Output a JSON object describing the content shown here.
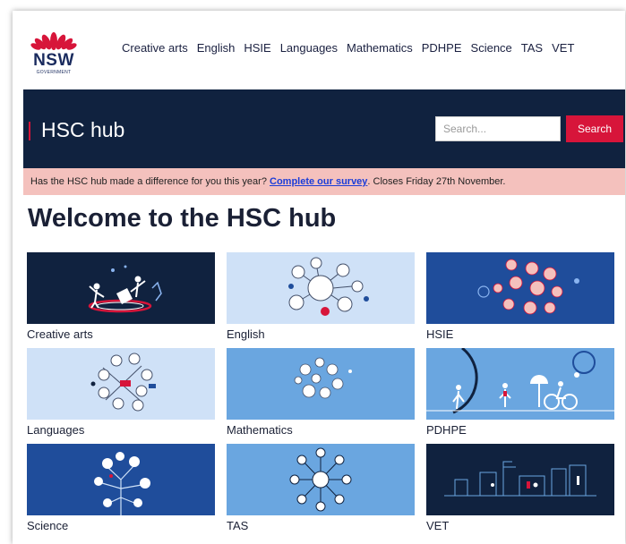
{
  "logo": {
    "text": "NSW",
    "subtext": "GOVERNMENT"
  },
  "nav": {
    "items": [
      "Creative arts",
      "English",
      "HSIE",
      "Languages",
      "Mathematics",
      "PDHPE",
      "Science",
      "TAS",
      "VET"
    ]
  },
  "banner": {
    "title": "HSC hub",
    "search_placeholder": "Search...",
    "search_button": "Search"
  },
  "notice": {
    "text_before": "Has the HSC hub made a difference for you this year? ",
    "link": "Complete our survey",
    "text_after": ". Closes Friday 27th November."
  },
  "heading": "Welcome to the HSC hub",
  "tiles": [
    {
      "label": "Creative arts",
      "bg": "#10223f"
    },
    {
      "label": "English",
      "bg": "#cfe1f7"
    },
    {
      "label": "HSIE",
      "bg": "#1f4d9b"
    },
    {
      "label": "Languages",
      "bg": "#cfe1f7"
    },
    {
      "label": "Mathematics",
      "bg": "#6aa6e0"
    },
    {
      "label": "PDHPE",
      "bg": "#6aa6e0"
    },
    {
      "label": "Science",
      "bg": "#1f4d9b"
    },
    {
      "label": "TAS",
      "bg": "#6aa6e0"
    },
    {
      "label": "VET",
      "bg": "#10223f"
    }
  ],
  "colors": {
    "navy": "#10223f",
    "red": "#d7153a",
    "notice": "#f4c1bd",
    "link": "#1a3cd8"
  }
}
